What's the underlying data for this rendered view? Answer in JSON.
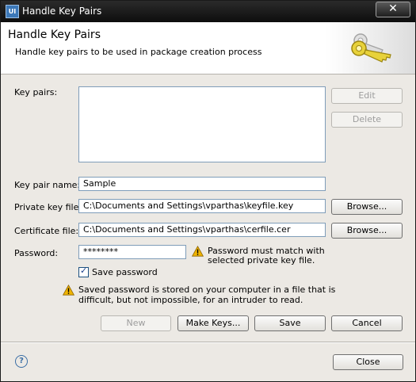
{
  "window": {
    "title": "Handle Key Pairs",
    "app_icon_text": "UI",
    "close_glyph": "✕"
  },
  "header": {
    "title": "Handle Key Pairs",
    "description": "Handle key pairs to be used in package creation process",
    "icon": "keys-icon"
  },
  "key_pairs": {
    "label": "Key pairs:",
    "items": [],
    "edit_label": "Edit",
    "delete_label": "Delete"
  },
  "form": {
    "key_pair_name_label": "Key pair name:",
    "key_pair_name_value": "Sample",
    "private_key_file_label": "Private key file:",
    "private_key_file_value": "C:\\Documents and Settings\\vparthas\\keyfile.key",
    "certificate_file_label": "Certificate file:",
    "certificate_file_value": "C:\\Documents and Settings\\vparthas\\cerfile.cer",
    "browse_label": "Browse...",
    "password_label": "Password:",
    "password_value": "********",
    "password_warning_line1": "Password must match with",
    "password_warning_line2": "selected private key file.",
    "save_password_label": "Save password",
    "save_password_checked": true,
    "saved_warning_line1": "Saved password is stored on your computer in a file that is",
    "saved_warning_line2": "difficult, but not impossible, for an intruder to read."
  },
  "actions": {
    "new_label": "New",
    "make_keys_label": "Make Keys...",
    "save_label": "Save",
    "cancel_label": "Cancel"
  },
  "footer": {
    "help_glyph": "?",
    "close_label": "Close"
  },
  "colors": {
    "warning": "#f0b400",
    "key_gold": "#e8d23a",
    "field_border": "#7f9db9"
  }
}
